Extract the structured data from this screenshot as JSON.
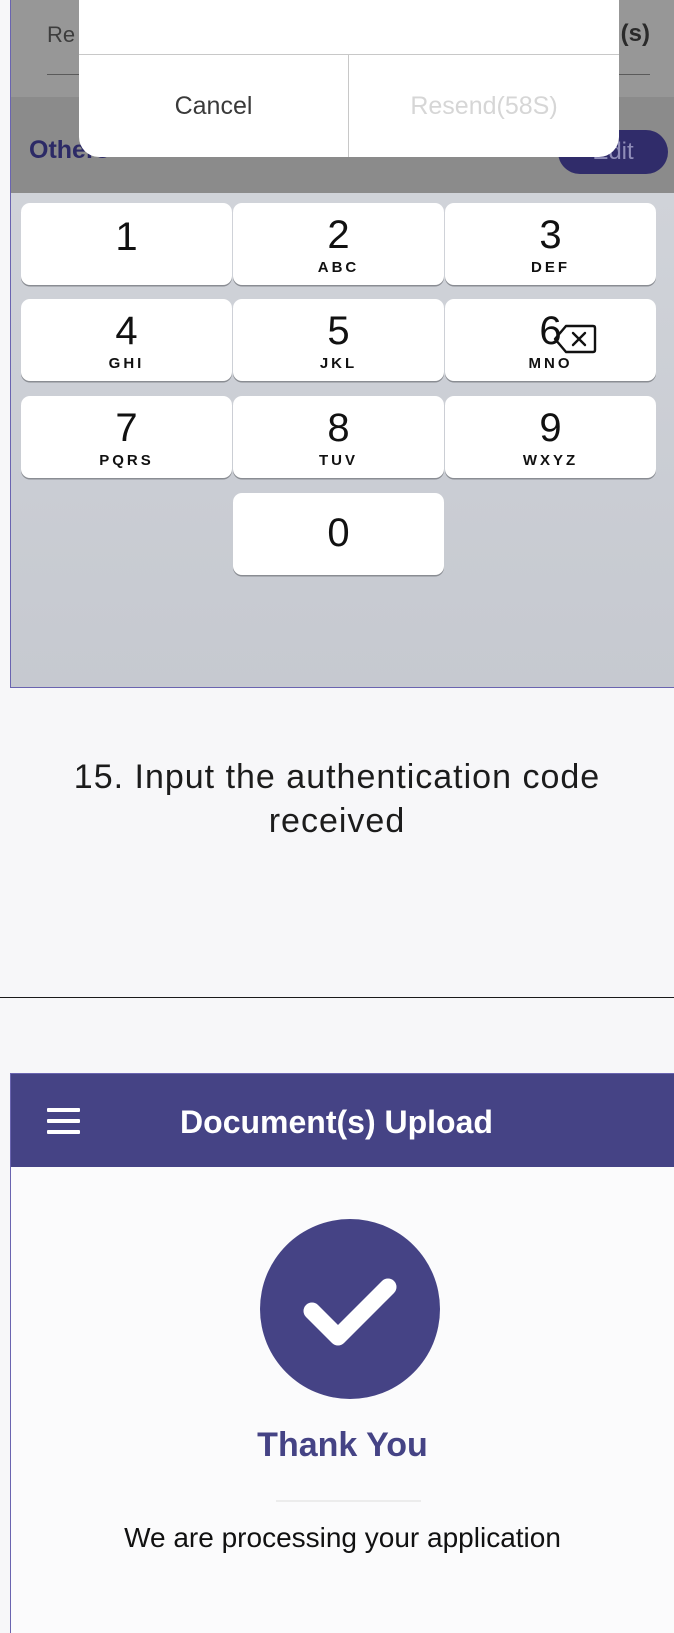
{
  "screen1": {
    "background": {
      "left_label": "Re",
      "right_label": "(s)",
      "others_label": "Others",
      "edit_label": "Edit"
    },
    "dialog": {
      "cancel_label": "Cancel",
      "resend_label": "Resend(58S)"
    },
    "keypad": {
      "keys": [
        {
          "digit": "1",
          "letters": ""
        },
        {
          "digit": "2",
          "letters": "ABC"
        },
        {
          "digit": "3",
          "letters": "DEF"
        },
        {
          "digit": "4",
          "letters": "GHI"
        },
        {
          "digit": "5",
          "letters": "JKL"
        },
        {
          "digit": "6",
          "letters": "MNO"
        },
        {
          "digit": "7",
          "letters": "PQRS"
        },
        {
          "digit": "8",
          "letters": "TUV"
        },
        {
          "digit": "9",
          "letters": "WXYZ"
        },
        {
          "digit": "0",
          "letters": ""
        }
      ],
      "delete_icon": "backspace-icon"
    }
  },
  "caption": {
    "line1": "15. Input the authentication code",
    "line2": "received"
  },
  "screen2": {
    "appbar": {
      "menu_icon": "hamburger-menu-icon",
      "title": "Document(s) Upload"
    },
    "status_icon": "checkmark-icon",
    "heading": "Thank You",
    "message": "We are processing your application"
  },
  "colors": {
    "brand": "#454385",
    "keypad_bg": "#c8cbd2",
    "key_bg": "#ffffff"
  }
}
